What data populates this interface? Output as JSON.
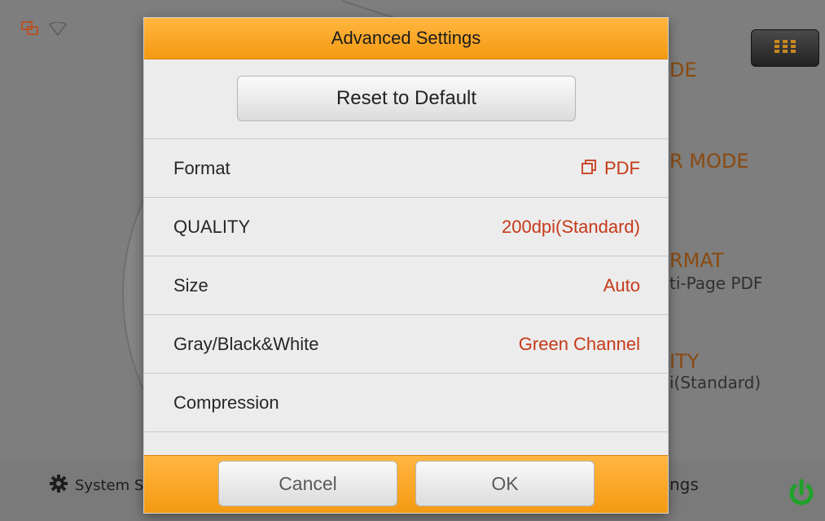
{
  "background": {
    "right_labels": [
      {
        "text": "DE",
        "style": "orange"
      },
      {
        "text": "R MODE",
        "style": "orange"
      },
      {
        "text": "RMAT",
        "style": "orange"
      },
      {
        "text": "ti-Page PDF",
        "style": "dark"
      },
      {
        "text": "ITY",
        "style": "orange"
      },
      {
        "text": "i(Standard)",
        "style": "dark"
      }
    ],
    "bottom_left_label": "System S",
    "bottom_right_label": "ngs",
    "icons": {
      "network": "network-icon",
      "wifi": "wifi-icon",
      "apps": "apps-grid-icon",
      "system": "gear-icon",
      "power": "power-icon"
    }
  },
  "dialog": {
    "title": "Advanced Settings",
    "reset_label": "Reset to Default",
    "rows": [
      {
        "label": "Format",
        "value": "PDF",
        "icon": "copy-icon"
      },
      {
        "label": "QUALITY",
        "value": "200dpi(Standard)"
      },
      {
        "label": "Size",
        "value": "Auto"
      },
      {
        "label": "Gray/Black&White",
        "value": "Green Channel"
      },
      {
        "label": "Compression",
        "value": ""
      }
    ],
    "cancel_label": "Cancel",
    "ok_label": "OK"
  },
  "colors": {
    "header_orange": "#F49A12",
    "value_red": "#C63A1A",
    "power_green": "#1FA12A"
  }
}
